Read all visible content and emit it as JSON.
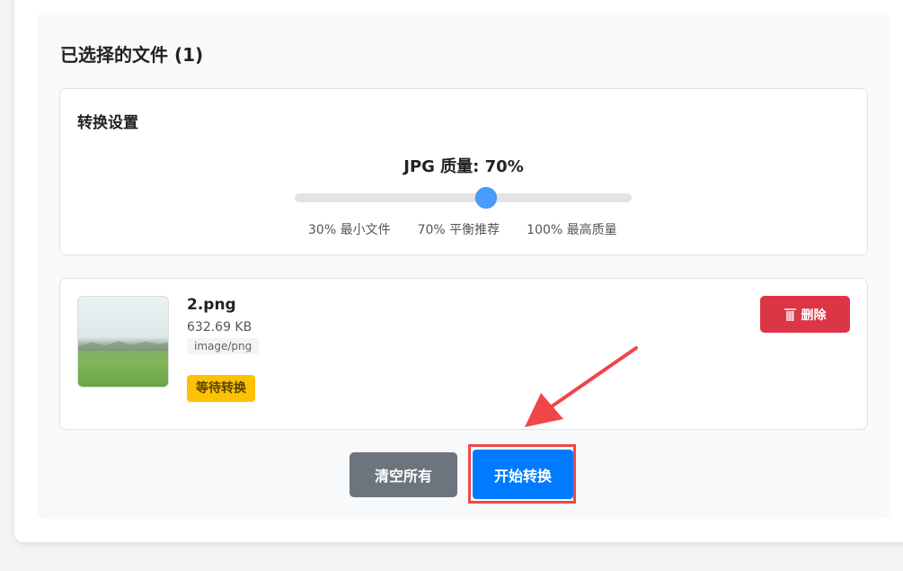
{
  "panel": {
    "title": "已选择的文件 (1)"
  },
  "settings": {
    "title": "转换设置",
    "quality_label": "JPG 质量: 70%",
    "quality_value": 70,
    "quality_min": 30,
    "quality_max": 100,
    "marks": [
      "30% 最小文件",
      "70% 平衡推荐",
      "100% 最高质量"
    ]
  },
  "file": {
    "name": "2.png",
    "size": "632.69 KB",
    "type": "image/png",
    "status": "等待转换",
    "delete_label": "删除"
  },
  "actions": {
    "clear_label": "清空所有",
    "start_label": "开始转换"
  },
  "colors": {
    "accent": "#007bff",
    "danger": "#dc3545",
    "warning": "#ffc107",
    "secondary": "#6c757d",
    "annotation": "#f0464a"
  }
}
